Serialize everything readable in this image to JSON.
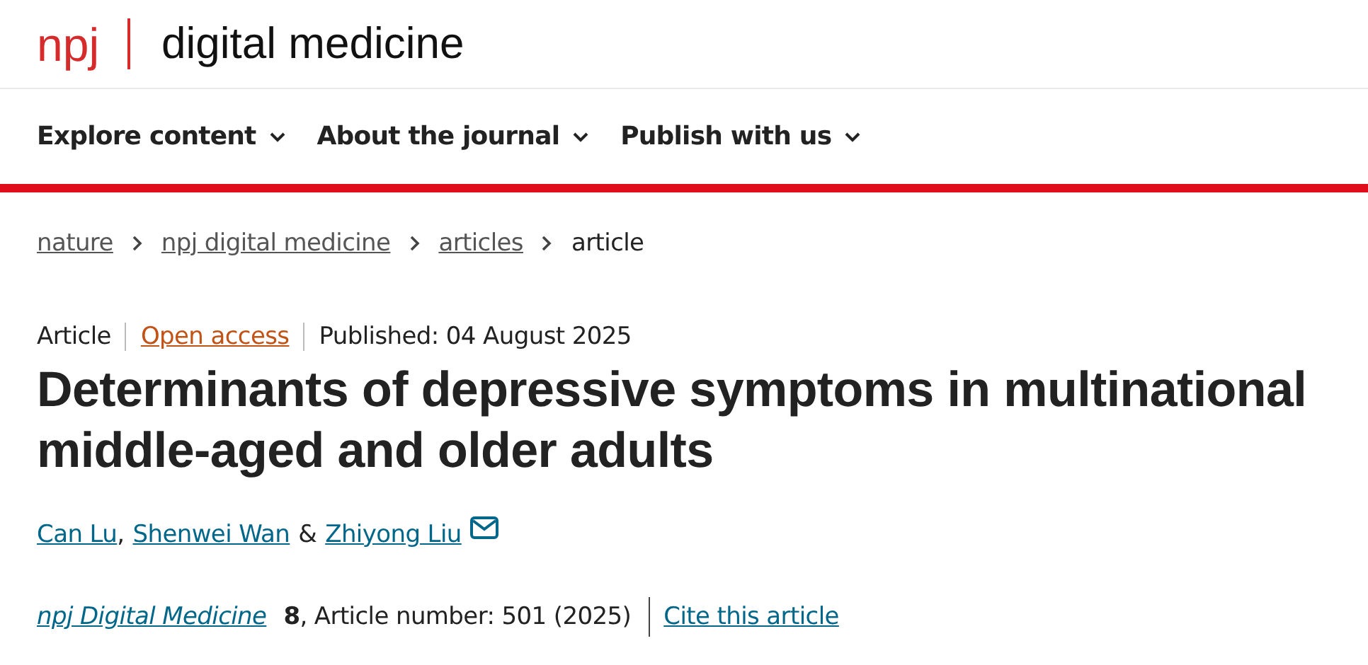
{
  "header": {
    "logo": "npj",
    "journal_name": "digital medicine"
  },
  "nav": [
    {
      "label": "Explore content",
      "has_menu": true
    },
    {
      "label": "About the journal",
      "has_menu": true
    },
    {
      "label": "Publish with us",
      "has_menu": true
    }
  ],
  "breadcrumbs": [
    {
      "label": "nature",
      "kind": "link"
    },
    {
      "label": "npj digital medicine",
      "kind": "link"
    },
    {
      "label": "articles",
      "kind": "link"
    },
    {
      "label": "article",
      "kind": "current"
    }
  ],
  "article_meta": {
    "type": "Article",
    "access": "Open access",
    "published": "Published: 04 August 2025"
  },
  "title": "Determinants of depressive symptoms in multinational middle-aged and older adults",
  "authors": [
    {
      "name": "Can Lu",
      "separator": ",",
      "email": false
    },
    {
      "name": "Shenwei Wan",
      "separator": "&",
      "email": false
    },
    {
      "name": "Zhiyong Liu",
      "email": true
    }
  ],
  "citation": {
    "journal": "npj Digital Medicine",
    "details": "**8**, Article number: 501 (2025)",
    "cite_link": "Cite this article"
  }
}
